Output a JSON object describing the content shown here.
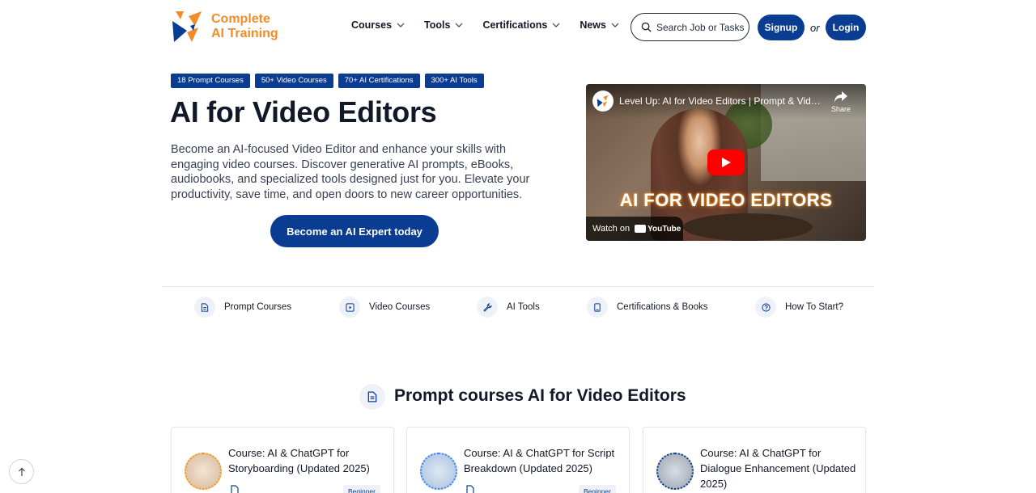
{
  "brand": {
    "line1": "Complete",
    "line2": "AI Training",
    "colors": {
      "primary": "#0a3d91",
      "accent": "#f28c28"
    }
  },
  "nav": {
    "items": [
      {
        "label": "Courses"
      },
      {
        "label": "Tools"
      },
      {
        "label": "Certifications"
      },
      {
        "label": "News"
      }
    ]
  },
  "header": {
    "search_label": "Search Job or Tasks",
    "signup_label": "Signup",
    "or_label": "or",
    "login_label": "Login"
  },
  "hero": {
    "badges": [
      "18 Prompt Courses",
      "50+ Video Courses",
      "70+ AI Certifications",
      "300+ AI Tools"
    ],
    "title": "AI for Video Editors",
    "description": "Become an AI-focused Video Editor and enhance your skills with engaging video courses. Discover generative AI prompts, eBooks, audiobooks, and specialized tools designed just for you. Elevate your productivity, save time, and open doors to new career opportunities.",
    "cta_label": "Become an AI Expert today"
  },
  "video": {
    "title": "Level Up: AI for Video Editors | Prompt & Video Courses",
    "share_label": "Share",
    "overlay_text": "AI FOR VIDEO EDITORS",
    "watch_label": "Watch on",
    "youtube_label": "YouTube"
  },
  "categories": [
    {
      "label": "Prompt Courses",
      "icon": "document-icon"
    },
    {
      "label": "Video Courses",
      "icon": "play-square-icon"
    },
    {
      "label": "AI Tools",
      "icon": "wrench-icon"
    },
    {
      "label": "Certifications & Books",
      "icon": "book-icon"
    },
    {
      "label": "How To Start?",
      "icon": "question-circle-icon"
    }
  ],
  "section": {
    "title": "Prompt courses AI for Video Editors"
  },
  "cards": [
    {
      "title": "Course: AI & ChatGPT for Storyboarding (Updated 2025)",
      "level": "Beginner"
    },
    {
      "title": "Course: AI & ChatGPT for Script Breakdown (Updated 2025)",
      "level": "Beginner"
    },
    {
      "title": "Course: AI & ChatGPT for Dialogue Enhancement (Updated 2025)",
      "level": ""
    }
  ]
}
